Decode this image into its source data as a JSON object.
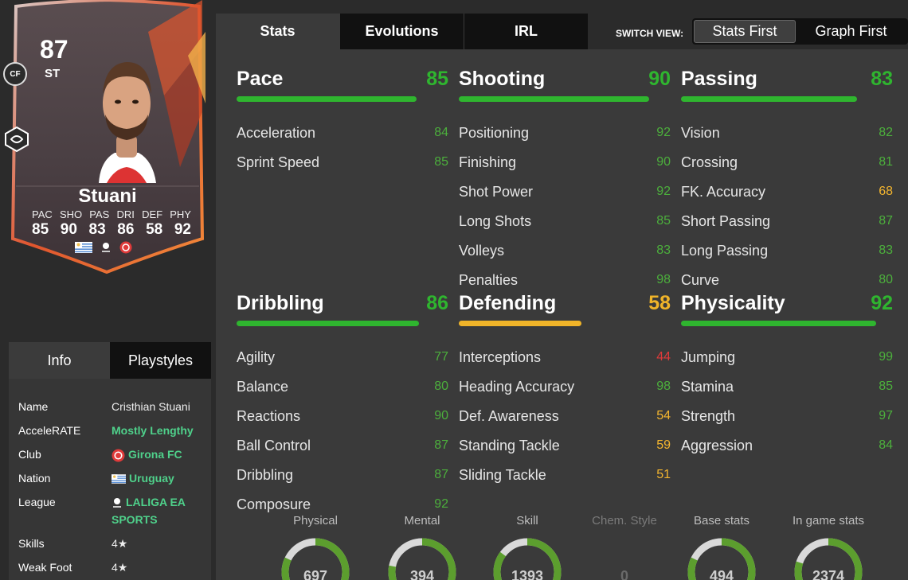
{
  "colors": {
    "green": "#2fb52f",
    "yellow": "#f0b429",
    "red": "#e0333a",
    "stat_green": "#4caf3c",
    "stat_yellow": "#f3b52f",
    "stat_red": "#e03a3a",
    "link_green": "#4fd18b"
  },
  "card": {
    "rating": "87",
    "position": "ST",
    "alt_position": "CF",
    "name": "Stuani",
    "attr_labels": [
      "PAC",
      "SHO",
      "PAS",
      "DRI",
      "DEF",
      "PHY"
    ],
    "attr_values": [
      "85",
      "90",
      "83",
      "86",
      "58",
      "92"
    ],
    "chem_icon": "chemistry-style-icon",
    "flags": [
      "uruguay-flag-icon",
      "laliga-logo-icon",
      "girona-crest-icon"
    ]
  },
  "info": {
    "tabs": [
      "Info",
      "Playstyles"
    ],
    "rows": [
      {
        "label": "Name",
        "value": "Cristhian Stuani",
        "link": false
      },
      {
        "label": "AcceleRATE",
        "value": "Mostly Lengthy",
        "link": true
      },
      {
        "label": "Club",
        "value": "Girona FC",
        "link": true,
        "icon": "girona-crest-icon"
      },
      {
        "label": "Nation",
        "value": "Uruguay",
        "link": true,
        "icon": "uruguay-flag-icon"
      },
      {
        "label": "League",
        "value": "LALIGA EA SPORTS",
        "link": true,
        "icon": "laliga-logo-icon"
      },
      {
        "label": "Skills",
        "value": "4★",
        "link": false
      },
      {
        "label": "Weak Foot",
        "value": "4★",
        "link": false
      }
    ]
  },
  "main": {
    "tabs": [
      "Stats",
      "Evolutions",
      "IRL"
    ],
    "switch_label": "SWITCH VIEW:",
    "switch_options": [
      "Stats First",
      "Graph First"
    ],
    "categories": [
      {
        "title": "Pace",
        "value": 85,
        "color": "green",
        "stats": [
          {
            "name": "Acceleration",
            "value": 84
          },
          {
            "name": "Sprint Speed",
            "value": 85
          }
        ]
      },
      {
        "title": "Shooting",
        "value": 90,
        "color": "green",
        "stats": [
          {
            "name": "Positioning",
            "value": 92
          },
          {
            "name": "Finishing",
            "value": 90
          },
          {
            "name": "Shot Power",
            "value": 92
          },
          {
            "name": "Long Shots",
            "value": 85
          },
          {
            "name": "Volleys",
            "value": 83
          },
          {
            "name": "Penalties",
            "value": 98
          }
        ]
      },
      {
        "title": "Passing",
        "value": 83,
        "color": "green",
        "stats": [
          {
            "name": "Vision",
            "value": 82
          },
          {
            "name": "Crossing",
            "value": 81
          },
          {
            "name": "FK. Accuracy",
            "value": 68
          },
          {
            "name": "Short Passing",
            "value": 87
          },
          {
            "name": "Long Passing",
            "value": 83
          },
          {
            "name": "Curve",
            "value": 80
          }
        ]
      },
      {
        "title": "Dribbling",
        "value": 86,
        "color": "green",
        "stats": [
          {
            "name": "Agility",
            "value": 77
          },
          {
            "name": "Balance",
            "value": 80
          },
          {
            "name": "Reactions",
            "value": 90
          },
          {
            "name": "Ball Control",
            "value": 87
          },
          {
            "name": "Dribbling",
            "value": 87
          },
          {
            "name": "Composure",
            "value": 92
          }
        ]
      },
      {
        "title": "Defending",
        "value": 58,
        "color": "yellow",
        "stats": [
          {
            "name": "Interceptions",
            "value": 44
          },
          {
            "name": "Heading Accuracy",
            "value": 98
          },
          {
            "name": "Def. Awareness",
            "value": 54
          },
          {
            "name": "Standing Tackle",
            "value": 59
          },
          {
            "name": "Sliding Tackle",
            "value": 51
          }
        ]
      },
      {
        "title": "Physicality",
        "value": 92,
        "color": "green",
        "stats": [
          {
            "name": "Jumping",
            "value": 99
          },
          {
            "name": "Stamina",
            "value": 85
          },
          {
            "name": "Strength",
            "value": 97
          },
          {
            "name": "Aggression",
            "value": 84
          }
        ]
      }
    ],
    "gauges": [
      {
        "label": "Physical",
        "value": "697",
        "fill": 0.82,
        "dim": false
      },
      {
        "label": "Mental",
        "value": "394",
        "fill": 0.78,
        "dim": false
      },
      {
        "label": "Skill",
        "value": "1393",
        "fill": 0.85,
        "dim": false
      },
      {
        "label": "Chem. Style",
        "value": "0",
        "fill": 0,
        "dim": true
      },
      {
        "label": "Base stats",
        "value": "494",
        "fill": 0.82,
        "dim": false
      },
      {
        "label": "In game stats",
        "value": "2374",
        "fill": 0.8,
        "dim": false
      }
    ]
  }
}
